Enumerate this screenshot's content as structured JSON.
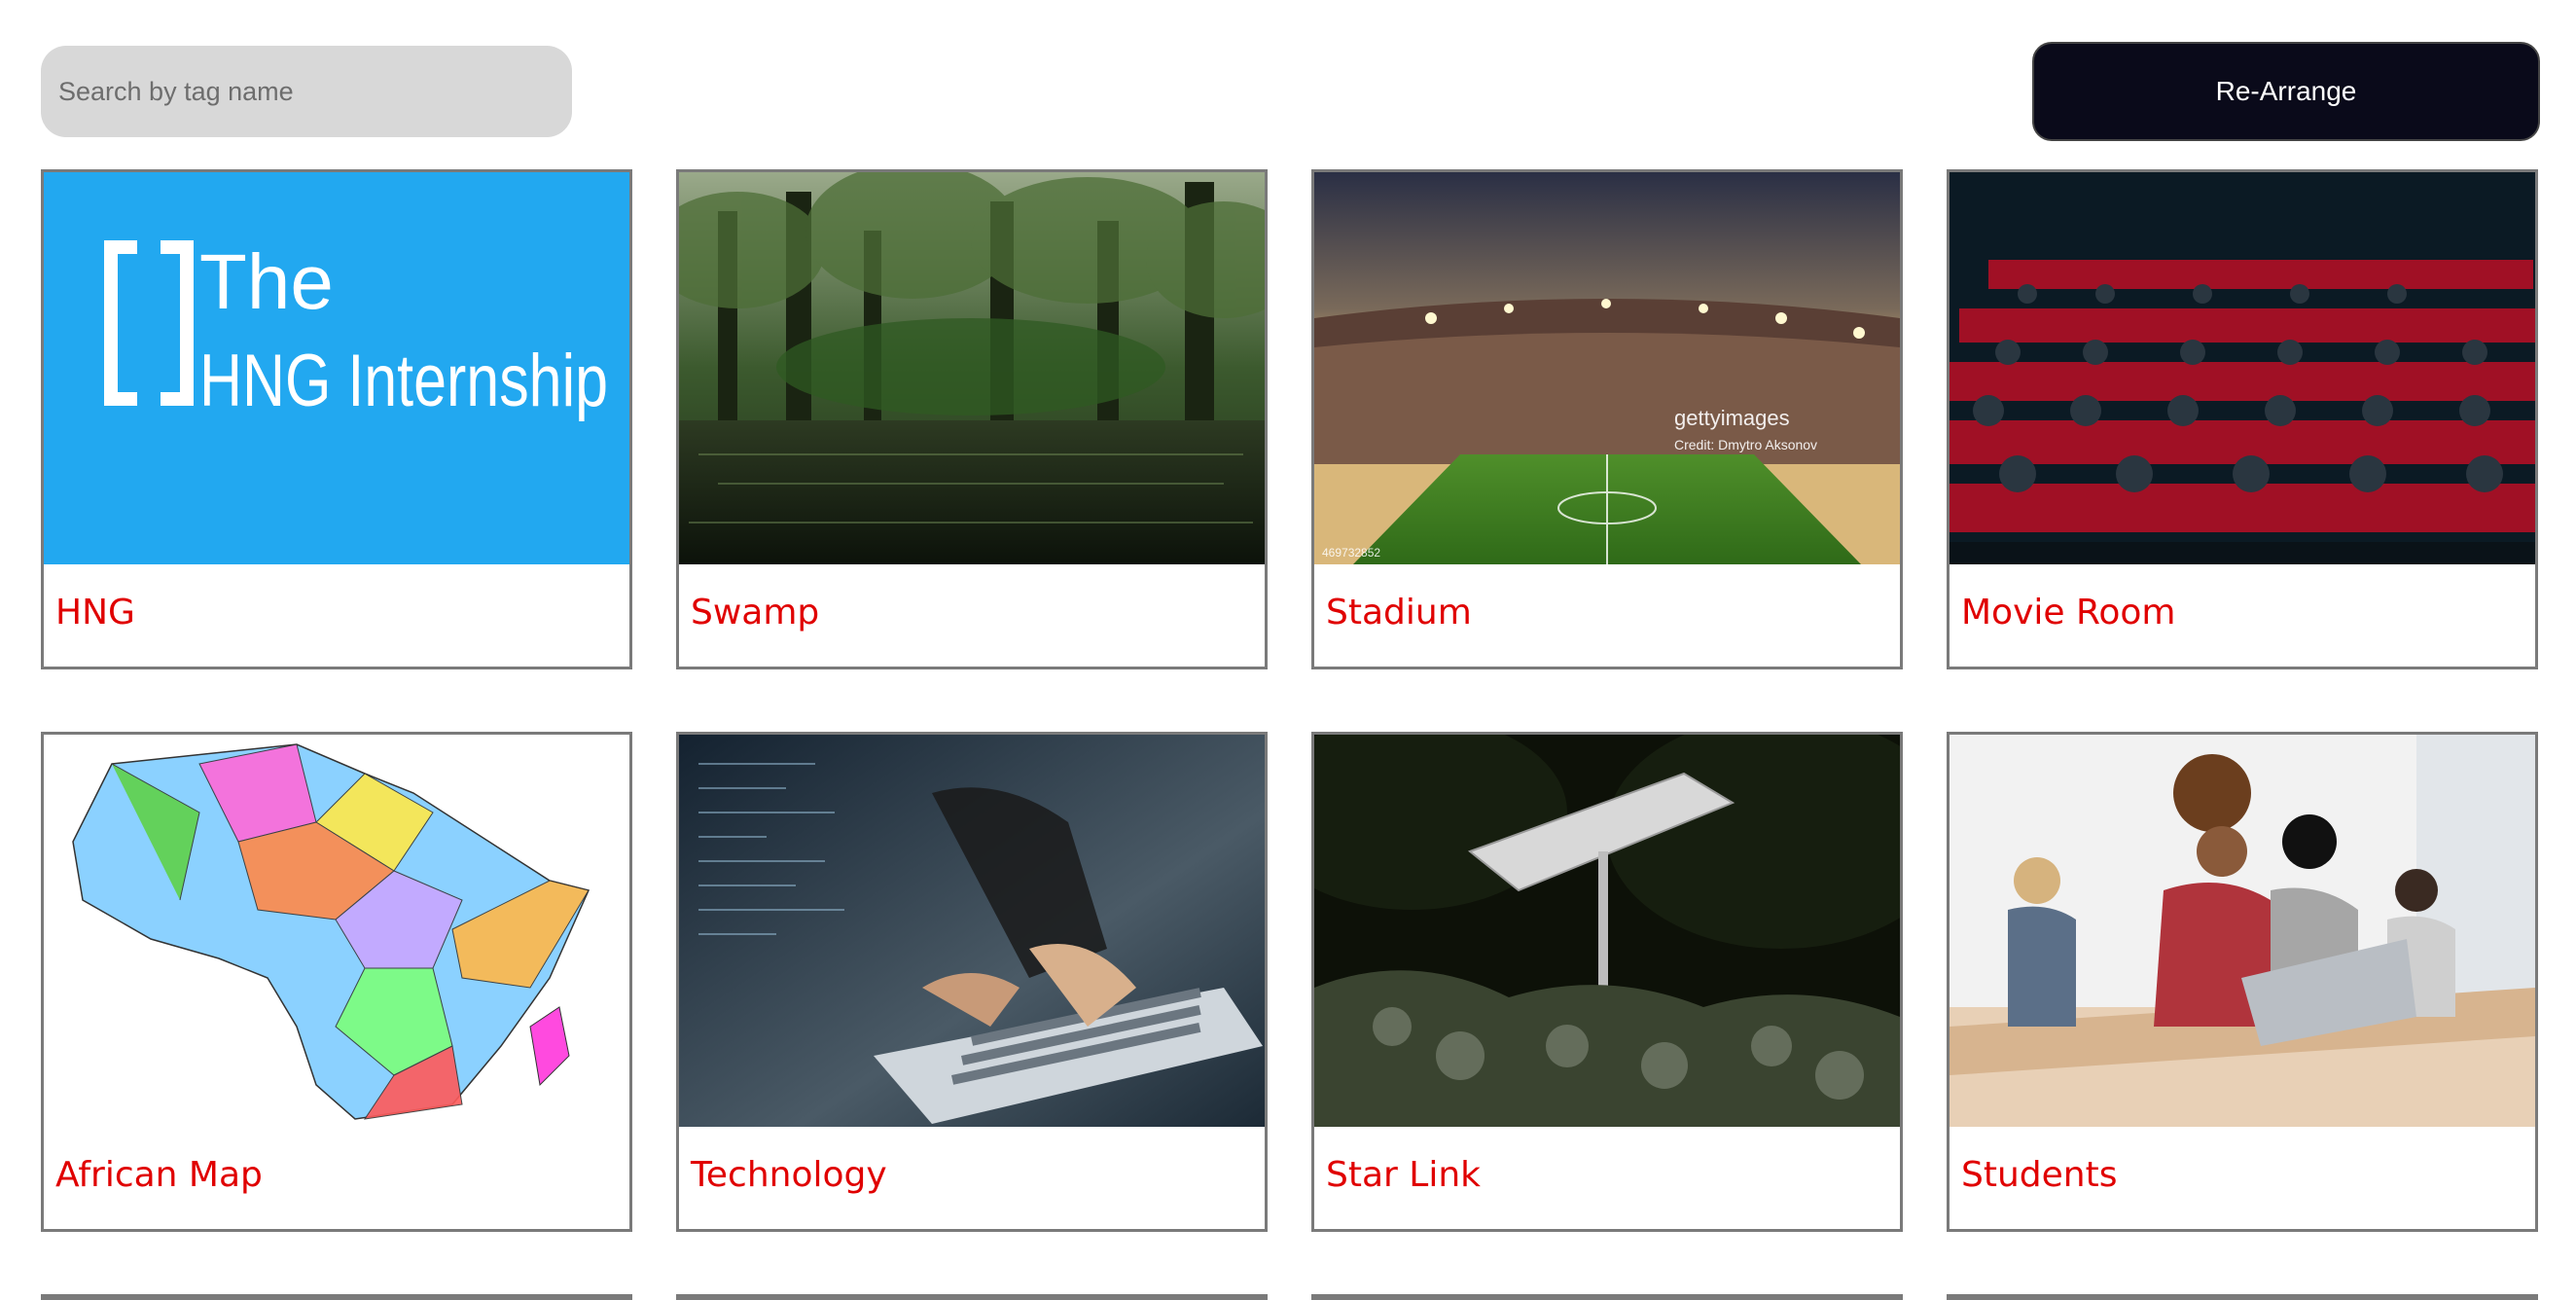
{
  "search": {
    "placeholder": "Search by tag name",
    "value": ""
  },
  "toolbar": {
    "rearrange_label": "Re-Arrange"
  },
  "gallery": {
    "cards": [
      {
        "label": "HNG",
        "image": "hng-logo-image"
      },
      {
        "label": "Swamp",
        "image": "swamp-image"
      },
      {
        "label": "Stadium",
        "image": "stadium-image"
      },
      {
        "label": "Movie Room",
        "image": "movie-room-image"
      },
      {
        "label": "African Map",
        "image": "african-map-image"
      },
      {
        "label": "Technology",
        "image": "technology-image"
      },
      {
        "label": "Star Link",
        "image": "star-link-image"
      },
      {
        "label": "Students",
        "image": "students-image"
      }
    ],
    "hng_logo": {
      "line1": "The",
      "line2": "HNG Internship"
    },
    "stadium_watermark": {
      "brand": "gettyimages",
      "credit": "Credit: Dmytro Aksonov",
      "id": "469732852"
    }
  },
  "colors": {
    "accent_label": "#e00000",
    "button_bg": "#0a0a1a",
    "search_bg": "#d8d8d8",
    "hng_blue": "#22a8f0",
    "card_border": "#7a7a7a"
  }
}
